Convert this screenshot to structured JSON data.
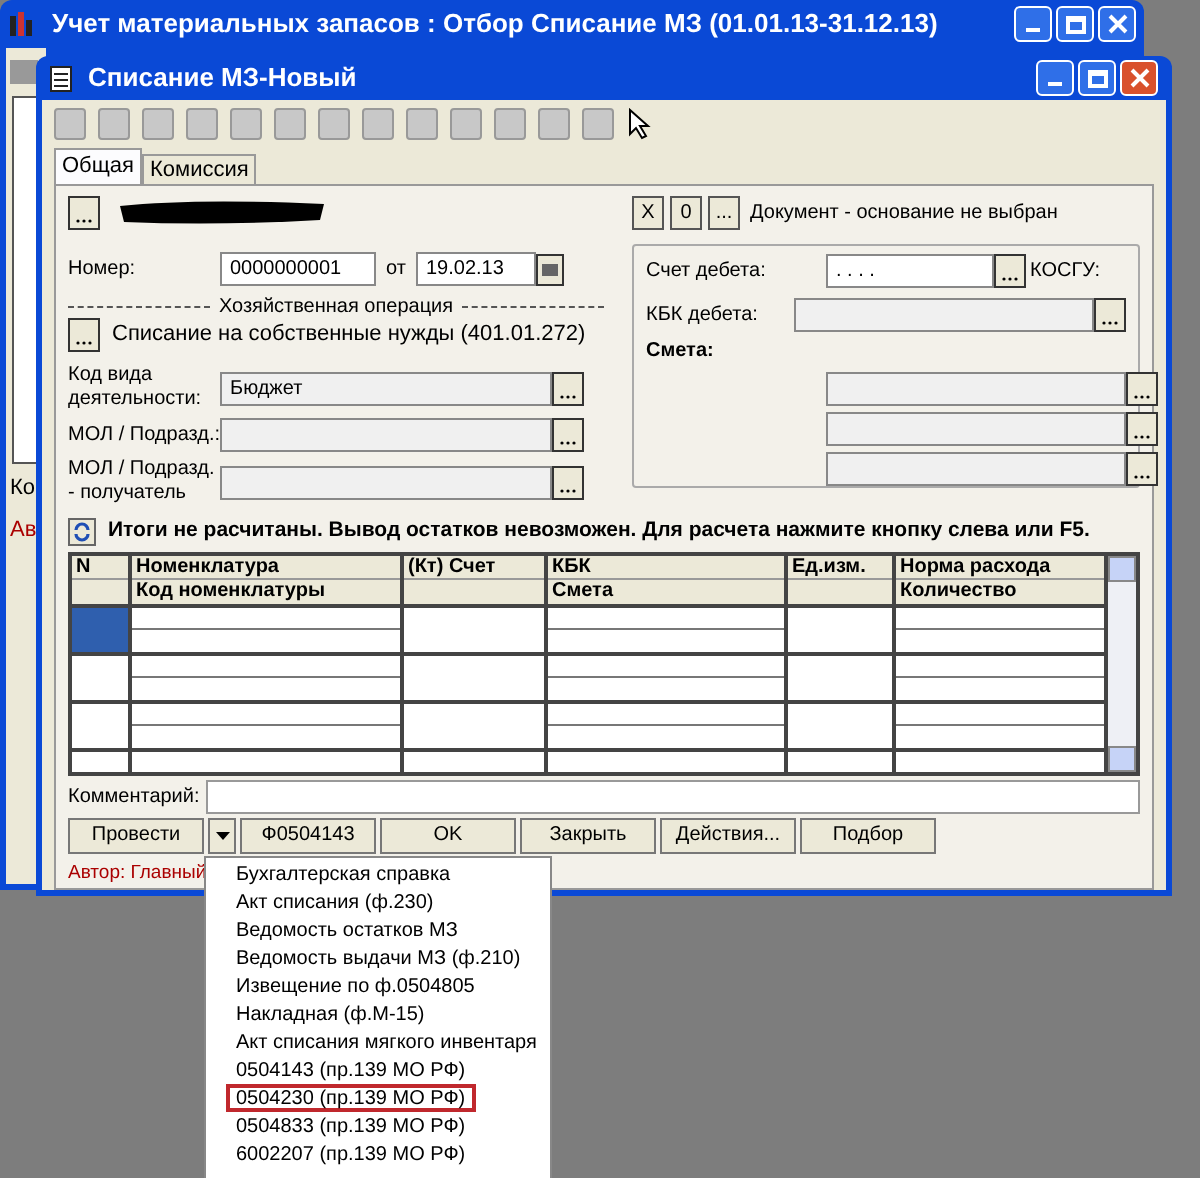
{
  "outer_window": {
    "title": "Учет материальных запасов : Отбор Списание МЗ (01.01.13-31.12.13)",
    "left_fragments": [
      "Ко",
      "Ав"
    ]
  },
  "window": {
    "title": "Списание МЗ-Новый"
  },
  "tabs": [
    {
      "label": "Общая",
      "selected": true
    },
    {
      "label": "Комиссия",
      "selected": false
    }
  ],
  "basis": {
    "buttons": [
      "X",
      "0",
      "..."
    ],
    "text": "Документ - основание не выбран"
  },
  "form": {
    "number_label": "Номер:",
    "number": "0000000001",
    "date_label": "от",
    "date": "19.02.13",
    "operation_caption": "Хозяйственная операция",
    "operation": "Списание на собственные нужды (401.01.272)",
    "activity_label": "Код вида деятельности:",
    "activity": "Бюджет",
    "mol_label": "МОЛ / Подразд.:",
    "mol_recipient_label": "МОЛ / Подразд. - получатель"
  },
  "debit": {
    "account_label": "Счет дебета:",
    "account": ". . . .",
    "kosgu_label": "КОСГУ:",
    "kbk_label": "КБК дебета:",
    "estimate_label": "Смета:"
  },
  "notice": "Итоги не расчитаны. Вывод остатков невозможен. Для расчета нажмите кнопку слева или F5.",
  "table": {
    "columns": [
      {
        "top": "N"
      },
      {
        "top": "Номенклатура",
        "bottom": "Код номенклатуры"
      },
      {
        "top": "(Кт) Счет"
      },
      {
        "top": "КБК",
        "bottom": "Смета"
      },
      {
        "top": "Ед.изм."
      },
      {
        "top": "Норма расхода",
        "bottom": "Количество"
      }
    ],
    "rows": [
      {
        "selected": true
      },
      {
        "selected": false
      },
      {
        "selected": false
      },
      {
        "selected": false
      }
    ]
  },
  "comment_label": "Комментарий:",
  "buttons": [
    "Провести",
    "Ф0504143",
    "OK",
    "Закрыть",
    "Действия...",
    "Подбор"
  ],
  "status": "Автор: Главный",
  "menu": [
    {
      "label": "Бухгалтерская справка",
      "selected": false
    },
    {
      "label": "Акт списания (ф.230)",
      "selected": false
    },
    {
      "label": "Ведомость остатков МЗ",
      "selected": false
    },
    {
      "label": "Ведомость выдачи МЗ (ф.210)",
      "selected": false
    },
    {
      "label": "Извещение по ф.0504805",
      "selected": false
    },
    {
      "label": "Накладная (ф.М-15)",
      "selected": false
    },
    {
      "label": "Акт списания мягкого инвентаря",
      "selected": false
    },
    {
      "label": "0504143 (пр.139 МО РФ)",
      "selected": false
    },
    {
      "label": "0504230 (пр.139 МО РФ)",
      "selected": true
    },
    {
      "label": "0504833 (пр.139 МО РФ)",
      "selected": false
    },
    {
      "label": "6002207 (пр.139 МО РФ)",
      "selected": false
    }
  ]
}
